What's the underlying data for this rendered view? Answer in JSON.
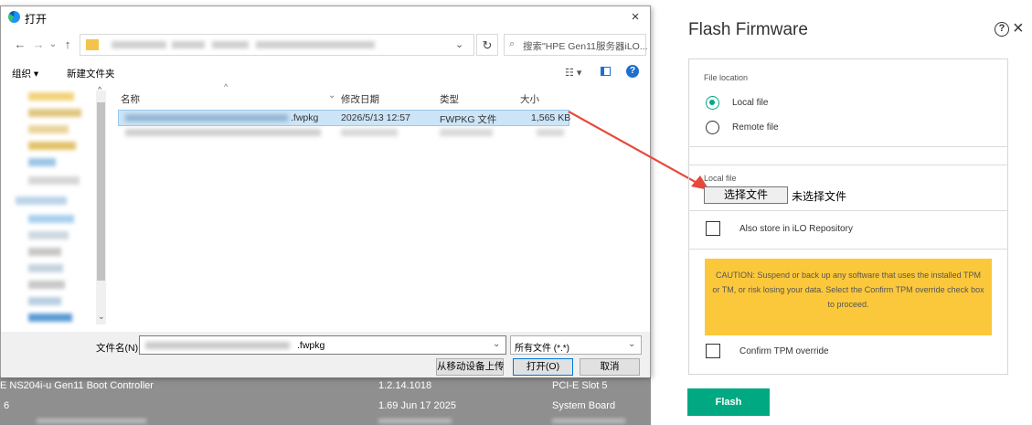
{
  "dialog": {
    "title": "打开",
    "close_glyph": "×",
    "nav": {
      "back": "←",
      "forward": "→",
      "recent": "⌄",
      "up": "↑"
    },
    "address_chevron": "⌄",
    "refresh_glyph": "↻",
    "search_icon": "⌕",
    "search_placeholder": "搜索\"HPE Gen11服务器iLO...",
    "toolbar": {
      "organize": "组织 ▾",
      "new_folder": "新建文件夹",
      "view": "☷ ▾",
      "help": "?"
    },
    "columns": {
      "name": "名称",
      "date": "修改日期",
      "type": "类型",
      "size": "大小"
    },
    "sort_glyph": "^",
    "date_chevron": "⌄",
    "nav_up_glyph": "^",
    "nav_down_glyph": "⌄",
    "file": {
      "name_suffix": ".fwpkg",
      "date": "2026/5/13 12:57",
      "type": "FWPKG 文件",
      "size": "1,565 KB"
    },
    "filename_label": "文件名(N):",
    "filename_suffix": ".fwpkg",
    "filetype_value": "所有文件 (*.*)",
    "filetype_chevron": "⌄",
    "filename_chevron": "⌄",
    "upload_button": "从移动设备上传",
    "open_button": "打开(O)",
    "cancel_button": "取消"
  },
  "background_table": {
    "rows": [
      {
        "name": "E NS204i-u Gen11 Boot Controller",
        "version": "1.2.14.1018",
        "location": "PCI-E Slot 5"
      },
      {
        "name": "6",
        "version": "1.69 Jun 17 2025",
        "location": "System Board"
      }
    ]
  },
  "flash_panel": {
    "title": "Flash Firmware",
    "help_glyph": "?",
    "close_glyph": "×",
    "file_location_label": "File location",
    "local_file_option": "Local file",
    "remote_file_option": "Remote file",
    "local_file_label": "Local file",
    "choose_file_button": "选择文件",
    "no_file_text": "未选择文件",
    "store_repo_label": "Also store in iLO Repository",
    "caution_text": "CAUTION: Suspend or back up any software that uses the installed TPM or TM, or risk losing your data. Select the Confirm TPM override check box to proceed.",
    "confirm_tpm_label": "Confirm TPM override",
    "flash_button": "Flash",
    "accent_color": "#01a982",
    "caution_color": "#fcc83b"
  }
}
